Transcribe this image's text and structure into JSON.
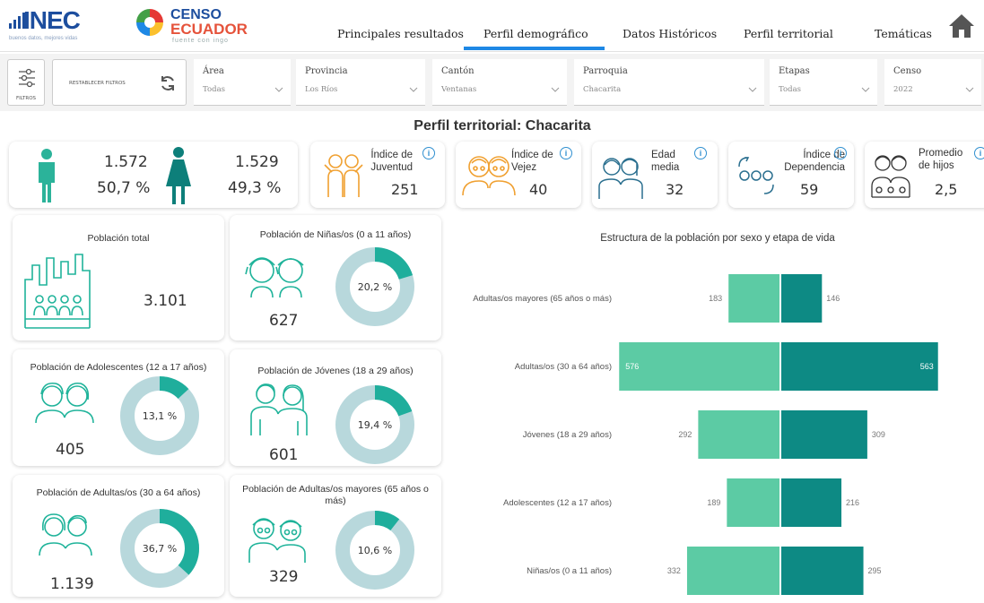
{
  "header": {
    "inec_logo": "INEC",
    "inec_tagline": "buenos datos, mejores vidas",
    "censo_logo_line1": "CENSO",
    "censo_logo_line2": "ECUADOR",
    "censo_logo_line3": "fuente con ingo",
    "tabs": [
      {
        "label": "Principales resultados",
        "active": false
      },
      {
        "label": "Perfil demográfico",
        "active": true
      },
      {
        "label": "Datos Históricos",
        "active": false
      },
      {
        "label": "Perfil territorial",
        "active": false
      },
      {
        "label": "Temáticas",
        "active": false
      }
    ],
    "home_icon": "home-icon"
  },
  "filters": {
    "toggle_label": "FILTROS",
    "reset_label": "RESTABLECER FILTROS",
    "items": [
      {
        "label": "Área",
        "value": "Todas"
      },
      {
        "label": "Provincia",
        "value": "Los Ríos"
      },
      {
        "label": "Cantón",
        "value": "Ventanas"
      },
      {
        "label": "Parroquia",
        "value": "Chacarita"
      },
      {
        "label": "Etapas",
        "value": "Todas"
      },
      {
        "label": "Censo",
        "value": "2022"
      }
    ]
  },
  "page_title": "Perfil territorial: Chacarita",
  "sex": {
    "male_count": "1.572",
    "male_pct": "50,7 %",
    "female_count": "1.529",
    "female_pct": "49,3 %",
    "colors": {
      "male": "#2bb39a",
      "female": "#0d7f7a"
    }
  },
  "indices": [
    {
      "label": "Índice de Juventud",
      "value": "251",
      "icon": "youth-icon",
      "info_icon": "info-icon"
    },
    {
      "label": "Índice de Vejez",
      "value": "40",
      "icon": "elderly-couple-icon",
      "info_icon": "info-icon"
    },
    {
      "label": "Edad media",
      "value": "32",
      "icon": "couple-icon",
      "info_icon": "info-icon"
    },
    {
      "label": "Índice de Dependencia",
      "value": "59",
      "icon": "dependency-icon",
      "info_icon": "info-icon"
    },
    {
      "label": "Promedio de hijos",
      "value": "2,5",
      "icon": "family-icon",
      "info_icon": "info-icon"
    }
  ],
  "total_population": {
    "title": "Población total",
    "value": "3.101"
  },
  "groups": [
    {
      "title": "Población de Niñas/os (0 a 11 años)",
      "count": "627",
      "pct_label": "20,2 %",
      "pct": 20.2
    },
    {
      "title": "Población de Adolescentes (12 a 17 años)",
      "count": "405",
      "pct_label": "13,1 %",
      "pct": 13.1
    },
    {
      "title": "Población de Jóvenes (18 a 29 años)",
      "count": "601",
      "pct_label": "19,4 %",
      "pct": 19.4
    },
    {
      "title": "Población de Adultas/os (30 a 64 años)",
      "count": "1.139",
      "pct_label": "36,7 %",
      "pct": 36.7
    },
    {
      "title": "Población de Adultas/os mayores (65 años o más)",
      "count": "329",
      "pct_label": "10,6 %",
      "pct": 10.6
    }
  ],
  "colors": {
    "teal_dark": "#0d8a84",
    "teal_light": "#5ccba4",
    "donut_fill": "#1fae9c",
    "donut_track": "#b8d8dc",
    "icon_stroke": "#1fb39a",
    "youth_icon": "#f0a030"
  },
  "chart_data": {
    "type": "bar",
    "orientation": "horizontal-diverging",
    "title": "Estructura de la población por sexo y etapa de vida",
    "categories": [
      "Adultas/os mayores (65 años o más)",
      "Adultas/os (30 a 64 años)",
      "Jóvenes (18 a 29 años)",
      "Adolescentes (12 a 17 años)",
      "Niñas/os (0 a 11 años)"
    ],
    "series": [
      {
        "values": [
          183,
          576,
          292,
          189,
          332
        ],
        "color": "#5ccba4"
      },
      {
        "values": [
          146,
          563,
          309,
          216,
          295
        ],
        "color": "#0d8a84"
      }
    ]
  }
}
